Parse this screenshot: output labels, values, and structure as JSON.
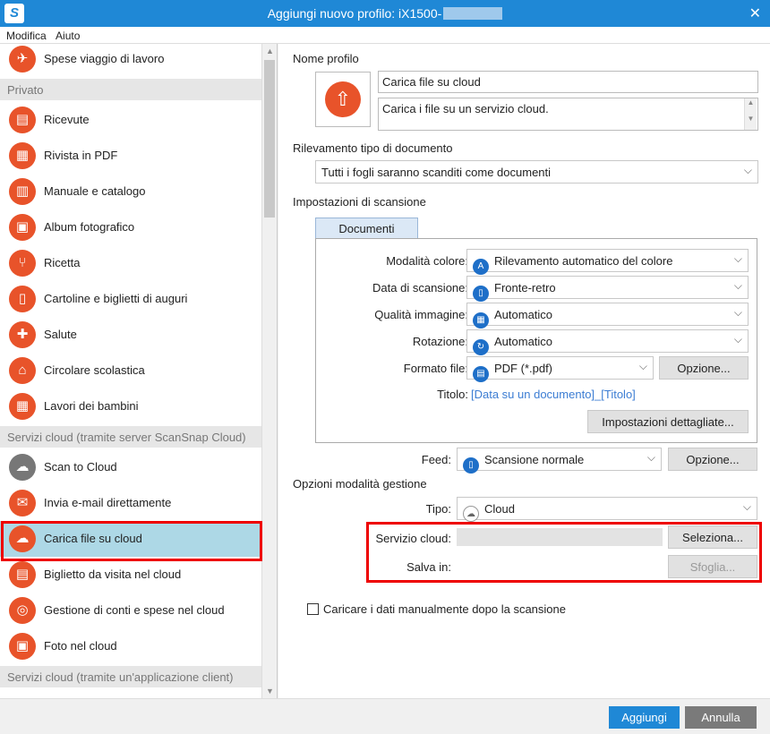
{
  "window": {
    "title": "Aggiungi nuovo profilo: iX1500-",
    "close_symbol": "✕"
  },
  "menu": {
    "items": [
      "Modifica",
      "Aiuto"
    ]
  },
  "sidebar": {
    "items": [
      {
        "label": "Spese viaggio di lavoro",
        "icon": "airplane-icon",
        "glyph": "✈"
      },
      {
        "group": "Privato"
      },
      {
        "label": "Ricevute",
        "icon": "receipt-icon",
        "glyph": "▤"
      },
      {
        "label": "Rivista in PDF",
        "icon": "magazine-icon",
        "glyph": "▦"
      },
      {
        "label": "Manuale e catalogo",
        "icon": "book-icon",
        "glyph": "▥"
      },
      {
        "label": "Album fotografico",
        "icon": "photo-album-icon",
        "glyph": "▣"
      },
      {
        "label": "Ricetta",
        "icon": "fork-knife-icon",
        "glyph": "⑂"
      },
      {
        "label": "Cartoline e biglietti di auguri",
        "icon": "postcard-icon",
        "glyph": "▯"
      },
      {
        "label": "Salute",
        "icon": "hospital-icon",
        "glyph": "✚"
      },
      {
        "label": "Circolare scolastica",
        "icon": "school-icon",
        "glyph": "⌂"
      },
      {
        "label": "Lavori dei bambini",
        "icon": "calendar-icon",
        "glyph": "▦"
      },
      {
        "group": "Servizi cloud (tramite server ScanSnap Cloud)"
      },
      {
        "label": "Scan to Cloud",
        "icon": "scansnap-cloud-icon",
        "glyph": "☁",
        "grey": true
      },
      {
        "label": "Invia e-mail direttamente",
        "icon": "email-icon",
        "glyph": "✉"
      },
      {
        "label": "Carica file su cloud",
        "icon": "cloud-upload-icon",
        "glyph": "☁",
        "selected": true
      },
      {
        "label": "Biglietto da visita nel cloud",
        "icon": "business-card-icon",
        "glyph": "▤"
      },
      {
        "label": "Gestione di conti e spese nel cloud",
        "icon": "coins-icon",
        "glyph": "◎"
      },
      {
        "label": "Foto nel cloud",
        "icon": "photo-icon",
        "glyph": "▣"
      },
      {
        "group": "Servizi cloud (tramite un'applicazione client)"
      }
    ]
  },
  "profile": {
    "section_label": "Nome profilo",
    "name": "Carica file su cloud",
    "description": "Carica i file su un servizio cloud.",
    "icon_glyph": "⇧"
  },
  "doc_detection": {
    "label": "Rilevamento tipo di documento",
    "value": "Tutti i fogli saranno scanditi come documenti"
  },
  "scan_settings": {
    "label": "Impostazioni di scansione",
    "tab": "Documenti",
    "color_mode": {
      "label": "Modalità colore:",
      "value": "Rilevamento automatico del colore",
      "icon": "color-auto-icon",
      "glyph": "A"
    },
    "scan_side": {
      "label": "Data di scansione:",
      "value": "Fronte-retro",
      "icon": "duplex-icon",
      "glyph": "▯"
    },
    "quality": {
      "label": "Qualità immagine:",
      "value": "Automatico",
      "icon": "quality-auto-icon",
      "glyph": "▦"
    },
    "rotation": {
      "label": "Rotazione:",
      "value": "Automatico",
      "icon": "rotation-icon",
      "glyph": "↻"
    },
    "file_format": {
      "label": "Formato file:",
      "value": "PDF (*.pdf)",
      "icon": "pdf-icon",
      "glyph": "▤",
      "option_button": "Opzione..."
    },
    "title": {
      "label": "Titolo:",
      "value": "[Data su un documento]_[Titolo]"
    },
    "detailed_button": "Impostazioni dettagliate..."
  },
  "feed": {
    "label": "Feed:",
    "value": "Scansione normale",
    "icon": "feed-icon",
    "glyph": "▯",
    "option_button": "Opzione..."
  },
  "management": {
    "label": "Opzioni modalità gestione",
    "type_label": "Tipo:",
    "type_value": "Cloud",
    "type_icon": "cloud-type-icon",
    "type_glyph": "☁",
    "service_label": "Servizio cloud:",
    "service_value": "",
    "select_button": "Seleziona...",
    "save_label": "Salva in:",
    "save_value": "",
    "browse_button": "Sfoglia..."
  },
  "manual_upload": {
    "label": "Caricare i dati manualmente dopo la scansione",
    "checked": false
  },
  "footer": {
    "ok": "Aggiungi",
    "cancel": "Annulla"
  },
  "chevron": "⌵",
  "scroll_up": "▲",
  "scroll_down": "▼"
}
